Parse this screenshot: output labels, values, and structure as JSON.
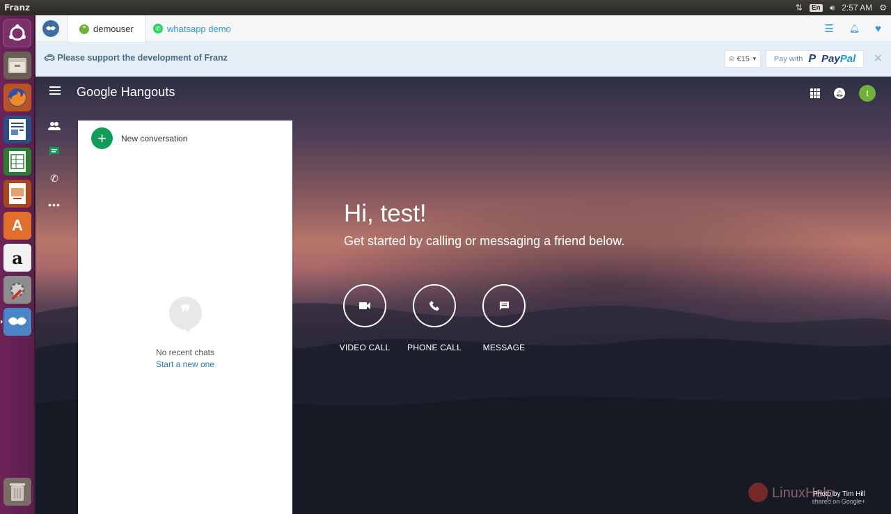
{
  "system_panel": {
    "app_title": "Franz",
    "keyboard": "En",
    "time": "2:57 AM"
  },
  "launcher": {
    "items": [
      "ubuntu-dash",
      "files",
      "firefox",
      "writer",
      "calc",
      "impress",
      "software-center",
      "amazon",
      "system-settings",
      "franz"
    ]
  },
  "franz": {
    "tabs": [
      {
        "label": "demouser",
        "icon": "hangouts-icon",
        "color": "#6fb23a",
        "active": true
      },
      {
        "label": "whatsapp demo",
        "icon": "whatsapp-icon",
        "color": "#25d366",
        "active": false
      }
    ],
    "support_bar": {
      "text": "Please support the development of Franz",
      "amount": "€15",
      "paypal_prefix": "Pay with",
      "paypal_brand_a": "Pay",
      "paypal_brand_b": "Pal"
    }
  },
  "hangouts": {
    "brand": "Google Hangouts",
    "avatar_letter": "t",
    "new_conversation": "New conversation",
    "empty_text": "No recent chats",
    "empty_link": "Start a new one",
    "greeting": "Hi, test!",
    "subtitle": "Get started by calling or messaging a friend below.",
    "actions": [
      {
        "label": "VIDEO CALL",
        "icon": "video-icon"
      },
      {
        "label": "PHONE CALL",
        "icon": "phone-icon"
      },
      {
        "label": "MESSAGE",
        "icon": "message-icon"
      }
    ],
    "photo_credit": "Photo by Tim Hill",
    "photo_source": "shared on Google+",
    "watermark": "LinuxHelp"
  },
  "colors": {
    "launcher": "#6d2359",
    "hangouts_green": "#0f9d58",
    "franz_blue": "#3498db"
  }
}
